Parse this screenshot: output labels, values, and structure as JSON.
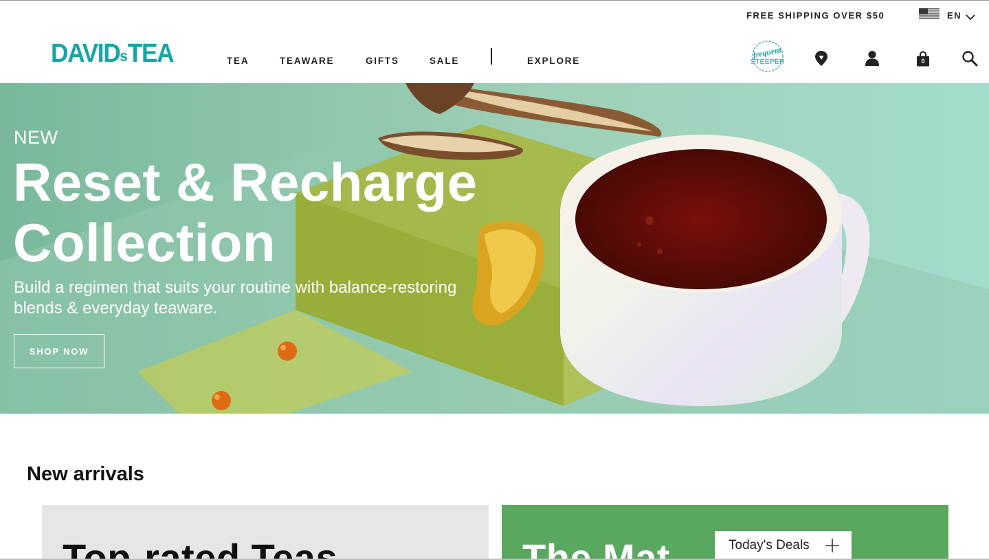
{
  "utility": {
    "shipping_text": "FREE SHIPPING OVER $50",
    "language": "EN",
    "flag_icon": "us-flag-icon",
    "chevron_icon": "chevron-down-icon"
  },
  "header": {
    "logo_main": "DAVIDS",
    "logo_s": "s",
    "logo_tea": "TEA",
    "nav": [
      "TEA",
      "TEAWARE",
      "GIFTS",
      "SALE",
      "EXPLORE"
    ],
    "badge_top": "frequent",
    "badge_bottom": "STEEPER",
    "icons": [
      "store-locator-icon",
      "account-icon",
      "cart-icon",
      "search-icon"
    ],
    "cart_count": "0"
  },
  "hero": {
    "kicker": "NEW",
    "title_line1": "Reset & Recharge",
    "title_line2": "Collection",
    "subtitle_line1": "Build a regimen that suits your routine with balance-restoring",
    "subtitle_line2": "blends & everyday teaware.",
    "cta": "SHOP NOW"
  },
  "new_arrivals": {
    "title": "New arrivals",
    "cards": [
      {
        "title": "Top-rated Teas"
      },
      {
        "title": "The Mat"
      }
    ]
  },
  "deals": {
    "label": "Today's Deals",
    "icon": "plus-icon"
  },
  "colors": {
    "brand": "#16a5a5",
    "text": "#222222",
    "hero_bg": "#9fd3bd",
    "card_green": "#5aa860"
  }
}
